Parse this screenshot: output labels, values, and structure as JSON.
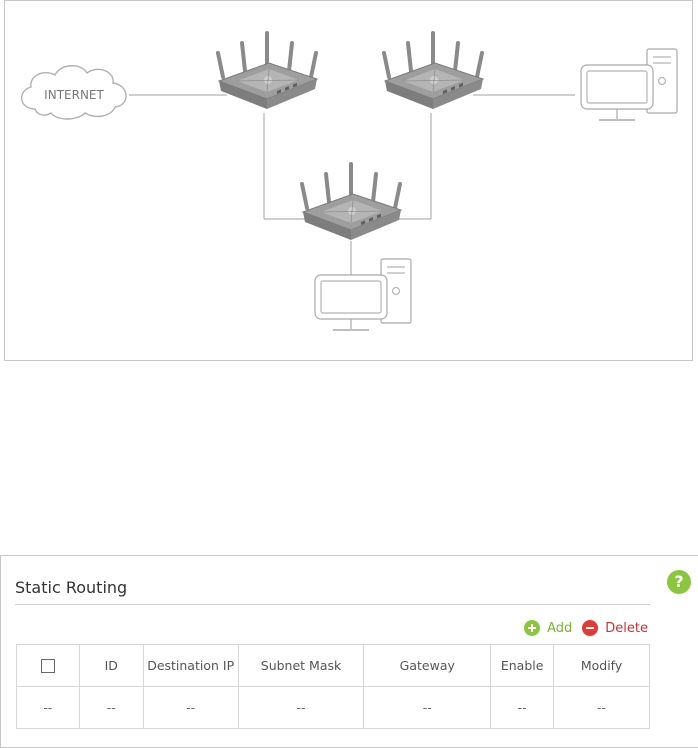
{
  "diagram": {
    "internet_label": "INTERNET"
  },
  "static_routing": {
    "title": "Static Routing",
    "help_symbol": "?",
    "add_label": "Add",
    "delete_label": "Delete",
    "columns": [
      "",
      "ID",
      "Destination IP",
      "Subnet Mask",
      "Gateway",
      "Enable",
      "Modify"
    ],
    "rows": [
      [
        "--",
        "--",
        "--",
        "--",
        "--",
        "--",
        "--"
      ]
    ],
    "colors": {
      "accent_green": "#8cc63f",
      "delete_red": "#e53935"
    }
  }
}
